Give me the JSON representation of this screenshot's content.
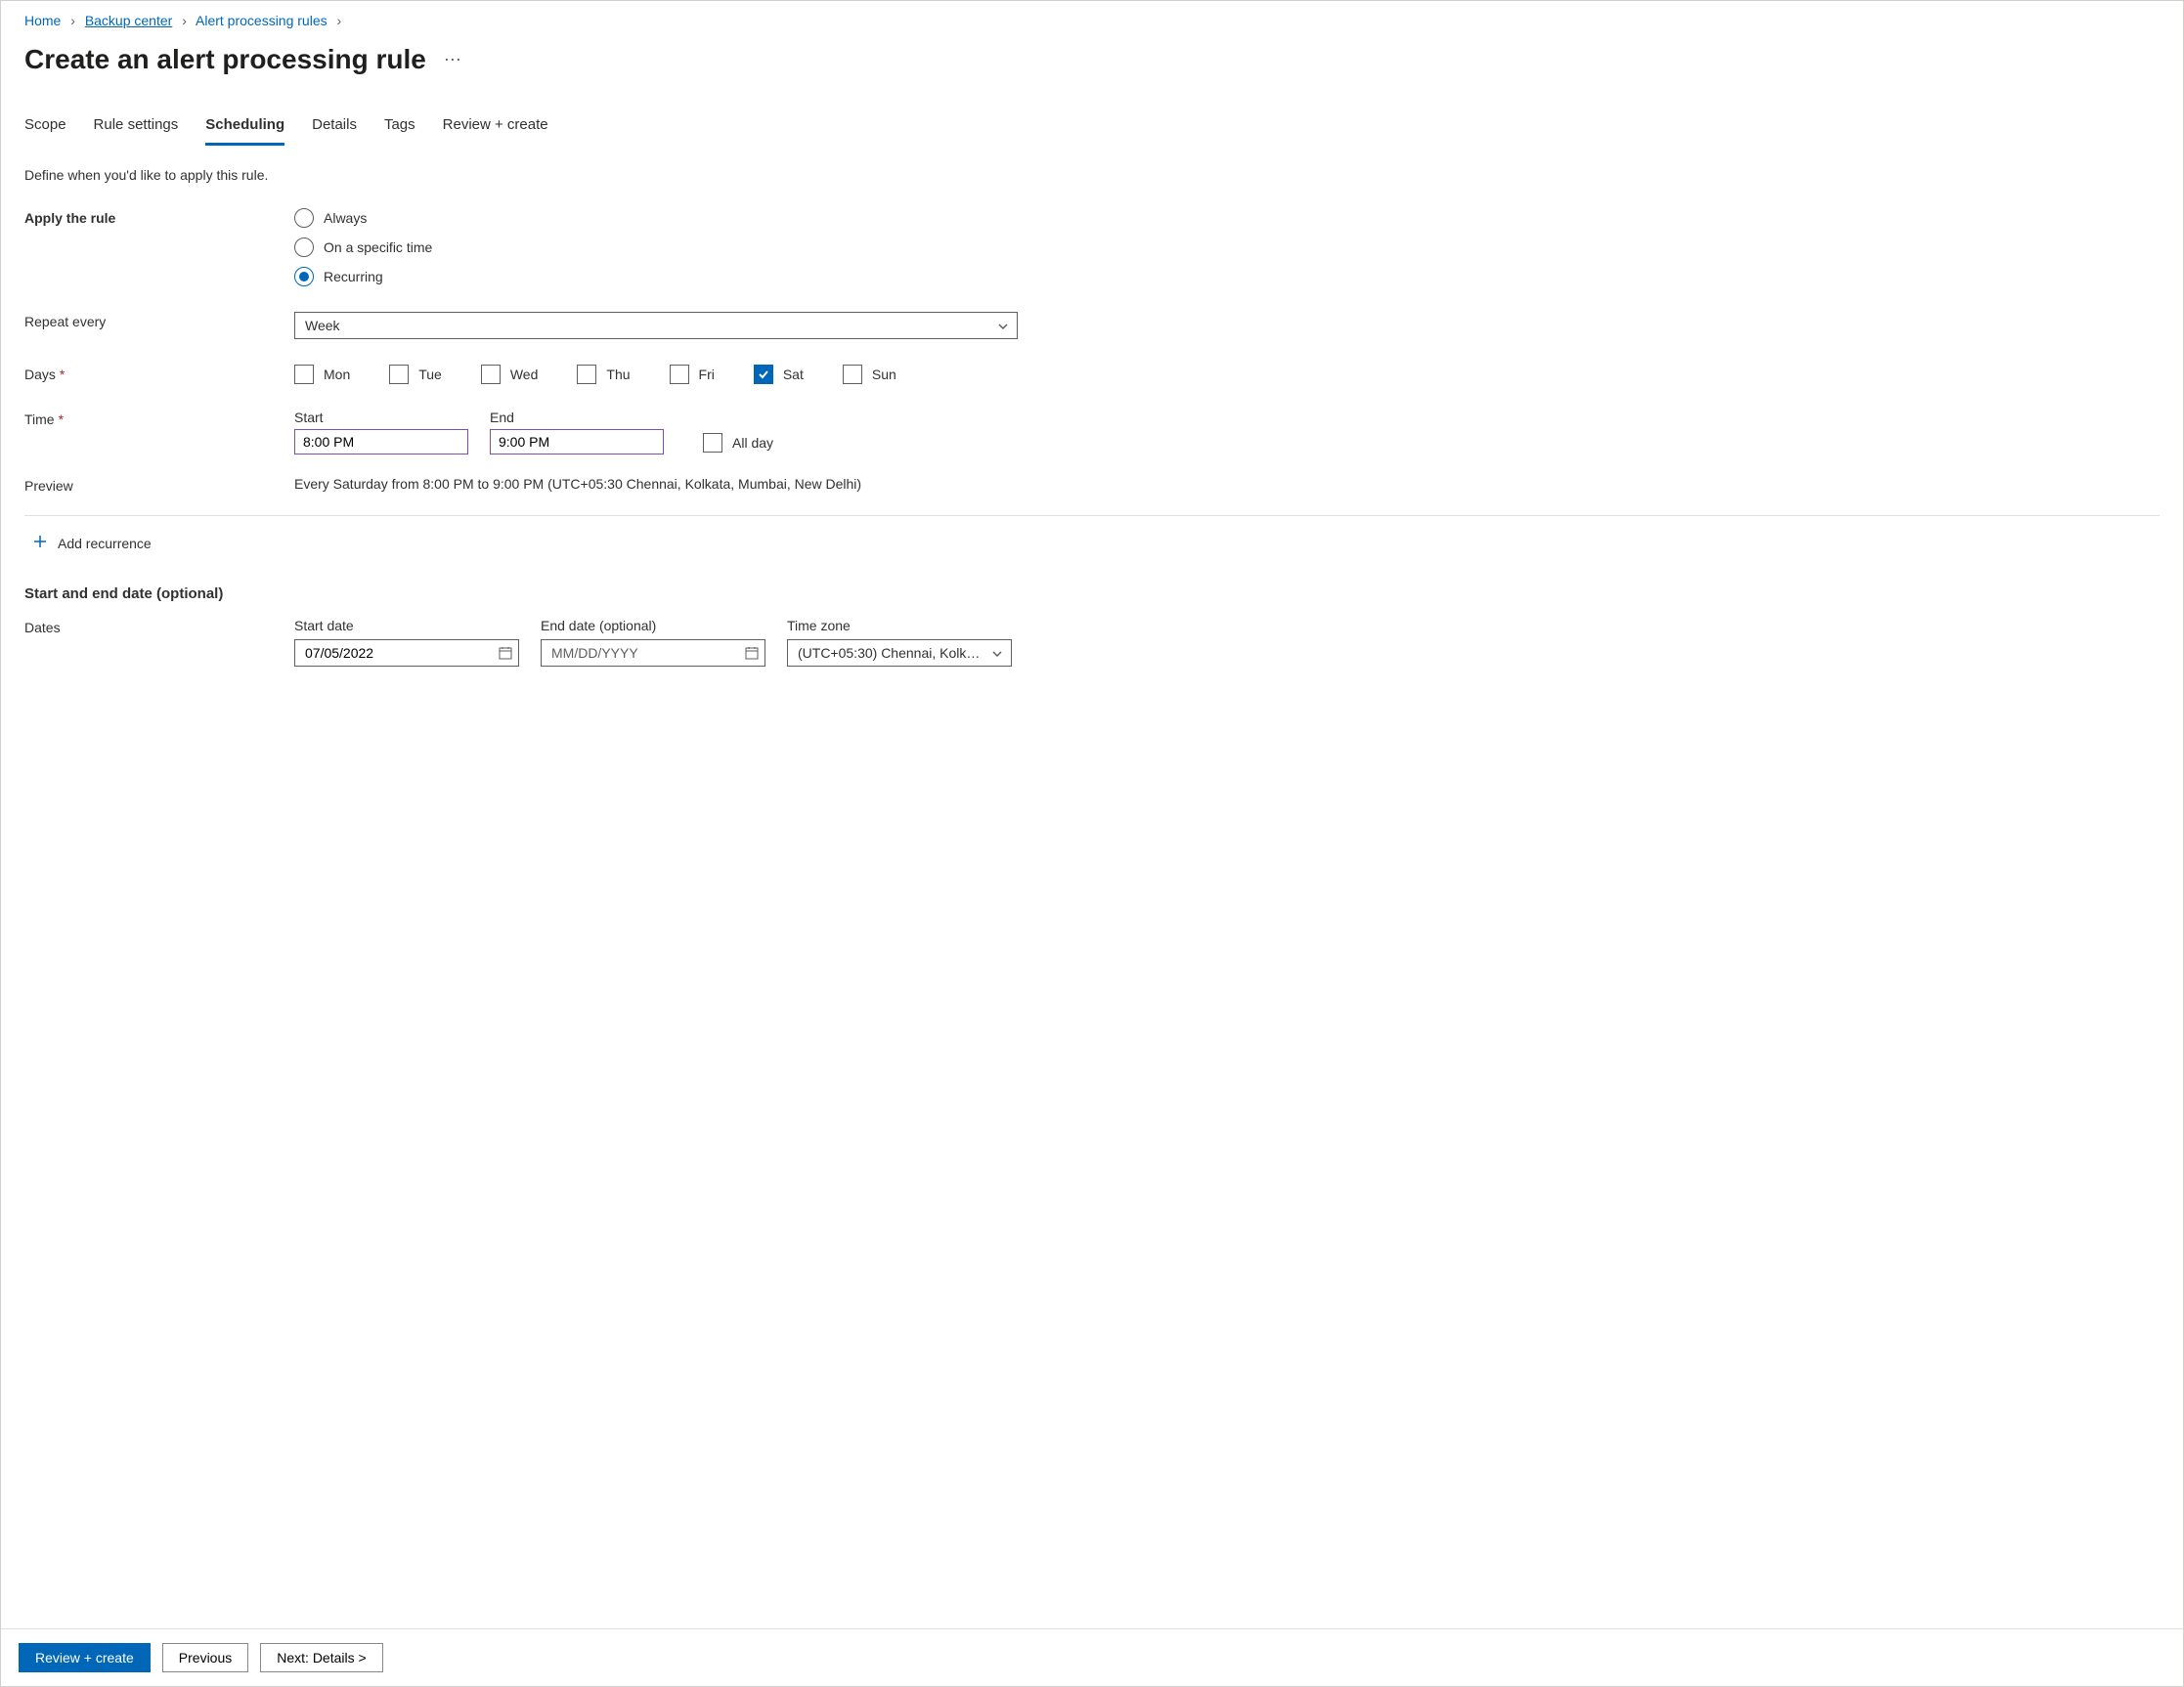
{
  "breadcrumb": {
    "items": [
      {
        "label": "Home"
      },
      {
        "label": "Backup center"
      },
      {
        "label": "Alert processing rules"
      }
    ]
  },
  "page": {
    "title": "Create an alert processing rule"
  },
  "tabs": [
    {
      "label": "Scope"
    },
    {
      "label": "Rule settings"
    },
    {
      "label": "Scheduling",
      "active": true
    },
    {
      "label": "Details"
    },
    {
      "label": "Tags"
    },
    {
      "label": "Review + create"
    }
  ],
  "intro": "Define when you'd like to apply this rule.",
  "apply": {
    "label": "Apply the rule",
    "options": {
      "always": "Always",
      "specific": "On a specific time",
      "recurring": "Recurring"
    },
    "selected": "recurring"
  },
  "repeat": {
    "label": "Repeat every",
    "value": "Week"
  },
  "days": {
    "label": "Days",
    "items": [
      {
        "label": "Mon",
        "checked": false
      },
      {
        "label": "Tue",
        "checked": false
      },
      {
        "label": "Wed",
        "checked": false
      },
      {
        "label": "Thu",
        "checked": false
      },
      {
        "label": "Fri",
        "checked": false
      },
      {
        "label": "Sat",
        "checked": true
      },
      {
        "label": "Sun",
        "checked": false
      }
    ]
  },
  "time": {
    "label": "Time",
    "start_label": "Start",
    "end_label": "End",
    "start_value": "8:00 PM",
    "end_value": "9:00 PM",
    "all_day_label": "All day",
    "all_day_checked": false
  },
  "preview": {
    "label": "Preview",
    "text": "Every Saturday from 8:00 PM to 9:00 PM (UTC+05:30 Chennai, Kolkata, Mumbai, New Delhi)"
  },
  "add_recurrence": "Add recurrence",
  "start_end": {
    "header": "Start and end date (optional)",
    "dates_label": "Dates",
    "start_label": "Start date",
    "end_label": "End date (optional)",
    "tz_label": "Time zone",
    "start_value": "07/05/2022",
    "end_placeholder": "MM/DD/YYYY",
    "tz_value": "(UTC+05:30) Chennai, Kolka..."
  },
  "footer": {
    "review": "Review + create",
    "previous": "Previous",
    "next": "Next: Details >"
  }
}
